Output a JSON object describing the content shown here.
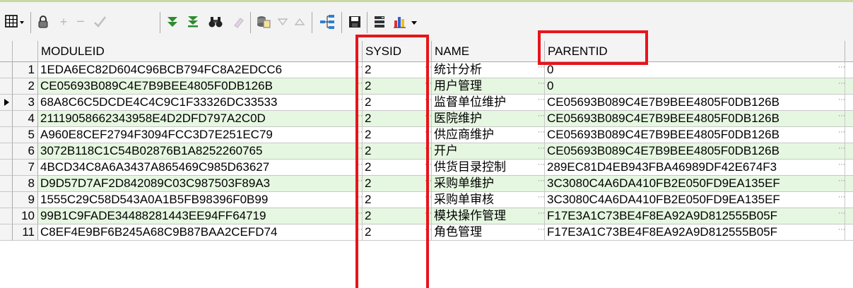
{
  "toolbar": {
    "icons": [
      "grid-menu-icon",
      "lock-icon",
      "plus-icon",
      "minus-icon",
      "check-icon",
      "filter-down-icon",
      "filter-last-icon",
      "binoculars-icon",
      "eraser-icon",
      "query-icon",
      "triangle-down-icon",
      "triangle-up-icon",
      "tree-icon",
      "save-icon",
      "db-icon",
      "chart-icon"
    ]
  },
  "columns": [
    "MODULEID",
    "SYSID",
    "NAME",
    "PARENTID"
  ],
  "current_row": 3,
  "rows": [
    {
      "n": "1",
      "moduleid": "1EDA6EC82D604C96BCB794FC8A2EDCC6",
      "sysid": "2",
      "name": "统计分析",
      "parentid": "0"
    },
    {
      "n": "2",
      "moduleid": "CE05693B089C4E7B9BEE4805F0DB126B",
      "sysid": "2",
      "name": "用户管理",
      "parentid": "0"
    },
    {
      "n": "3",
      "moduleid": "68A8C6C5DCDE4C4C9C1F33326DC33533",
      "sysid": "2",
      "name": "监督单位维护",
      "parentid": "CE05693B089C4E7B9BEE4805F0DB126B"
    },
    {
      "n": "4",
      "moduleid": "21119058662343958E4D2DFD797A2C0D",
      "sysid": "2",
      "name": "医院维护",
      "parentid": "CE05693B089C4E7B9BEE4805F0DB126B"
    },
    {
      "n": "5",
      "moduleid": "A960E8CEF2794F3094FCC3D7E251EC79",
      "sysid": "2",
      "name": "供应商维护",
      "parentid": "CE05693B089C4E7B9BEE4805F0DB126B"
    },
    {
      "n": "6",
      "moduleid": "3072B118C1C54B02876B1A8252260765",
      "sysid": "2",
      "name": "开户",
      "parentid": "CE05693B089C4E7B9BEE4805F0DB126B"
    },
    {
      "n": "7",
      "moduleid": "4BCD34C8A6A3437A865469C985D63627",
      "sysid": "2",
      "name": "供货目录控制",
      "parentid": "289EC81D4EB943FBA46989DF42E674F3"
    },
    {
      "n": "8",
      "moduleid": "D9D57D7AF2D842089C03C987503F89A3",
      "sysid": "2",
      "name": "采购单维护",
      "parentid": "3C3080C4A6DA410FB2E050FD9EA135EF"
    },
    {
      "n": "9",
      "moduleid": "1555C29C58D543A0A1B5FB98396F0B99",
      "sysid": "2",
      "name": "采购单审核",
      "parentid": "3C3080C4A6DA410FB2E050FD9EA135EF"
    },
    {
      "n": "10",
      "moduleid": "99B1C9FADE34488281443EE94FF64719",
      "sysid": "2",
      "name": "模块操作管理",
      "parentid": "F17E3A1C73BE4F8EA92A9D812555B05F"
    },
    {
      "n": "11",
      "moduleid": "C8EF4E9BF6B245A68C9B87BAA2CEFD74",
      "sysid": "2",
      "name": "角色管理",
      "parentid": "F17E3A1C73BE4F8EA92A9D812555B05F"
    }
  ],
  "colors": {
    "row_alt": "#e6f7e1",
    "highlight": "#e8141b"
  }
}
